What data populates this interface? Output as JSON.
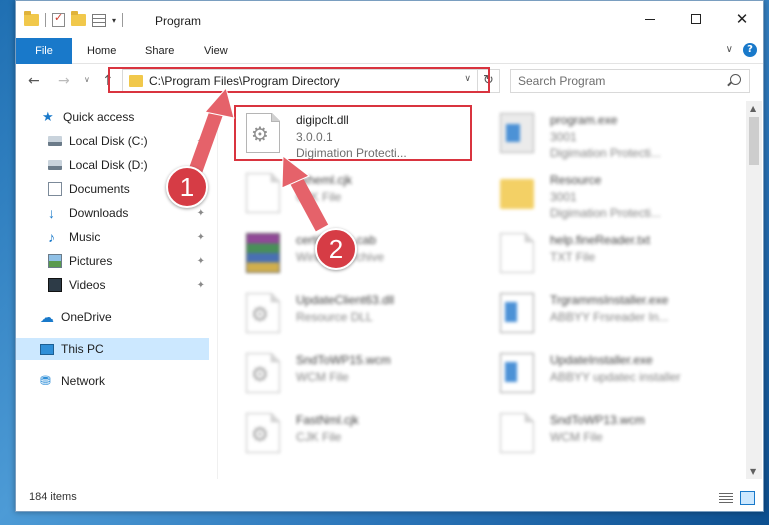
{
  "window": {
    "title": "Program",
    "min_glyph": "—",
    "close_glyph": "✕"
  },
  "ribbon": {
    "tabs": [
      "File",
      "Home",
      "Share",
      "View"
    ],
    "expand_glyph": "∨",
    "help_glyph": "?"
  },
  "address": {
    "path": "C:\\Program Files\\Program Directory",
    "back_glyph": "←",
    "forward_glyph": "→",
    "recent_glyph": "∨",
    "up_glyph": "↑",
    "dropdown_glyph": "∨",
    "refresh_glyph": "↻"
  },
  "search": {
    "placeholder": "Search Program"
  },
  "sidebar": {
    "items": [
      {
        "label": "Quick access",
        "icon": "star-icon"
      },
      {
        "label": "Local Disk (C:)",
        "icon": "drive-icon",
        "pinned": true
      },
      {
        "label": "Local Disk (D:)",
        "icon": "drive-icon",
        "pinned": true
      },
      {
        "label": "Documents",
        "icon": "documents-icon",
        "pinned": true
      },
      {
        "label": "Downloads",
        "icon": "download-icon",
        "pinned": true
      },
      {
        "label": "Music",
        "icon": "music-icon",
        "pinned": true
      },
      {
        "label": "Pictures",
        "icon": "pictures-icon",
        "pinned": true
      },
      {
        "label": "Videos",
        "icon": "videos-icon",
        "pinned": true
      },
      {
        "label": "OneDrive",
        "icon": "cloud-icon"
      },
      {
        "label": "This PC",
        "icon": "pc-icon",
        "selected": true
      },
      {
        "label": "Network",
        "icon": "network-icon"
      }
    ],
    "pin_glyph": "📌"
  },
  "files": [
    {
      "name": "digipclt.dll",
      "meta1": "3.0.0.1",
      "meta2": "Digimation Protecti...",
      "icon": "dll-icon",
      "highlighted": true
    },
    {
      "name": "program.exe",
      "meta1": "3001",
      "meta2": "Digimation Protecti...",
      "icon": "exe-icon"
    },
    {
      "name": "fixheml.cjk",
      "meta1": "CJK File",
      "meta2": "",
      "icon": "file-icon"
    },
    {
      "name": "Resource",
      "meta1": "3001",
      "meta2": "Digimation Protecti...",
      "icon": "folder-icon"
    },
    {
      "name": "certificates.cab",
      "meta1": "WinRAR archive",
      "meta2": "",
      "icon": "archive-icon"
    },
    {
      "name": "help.fineReader.txt",
      "meta1": "TXT File",
      "meta2": "",
      "icon": "file-icon"
    },
    {
      "name": "UpdateClient63.dll",
      "meta1": "Resource DLL",
      "meta2": "",
      "icon": "dll-icon"
    },
    {
      "name": "TrgrammsInstaller.exe",
      "meta1": "ABBYY Frsreader In...",
      "meta2": "",
      "icon": "installer-icon"
    },
    {
      "name": "SndToWP15.wcm",
      "meta1": "WCM File",
      "meta2": "",
      "icon": "dll-icon"
    },
    {
      "name": "UpdateInstaller.exe",
      "meta1": "ABBYY updatec installer",
      "meta2": "",
      "icon": "installer-icon"
    },
    {
      "name": "FastNml.cjk",
      "meta1": "CJK File",
      "meta2": "",
      "icon": "dll-icon"
    },
    {
      "name": "SndToWP13.wcm",
      "meta1": "WCM File",
      "meta2": "",
      "icon": "file-icon"
    }
  ],
  "status": {
    "item_count": "184 items"
  },
  "annotations": {
    "badge_1": "1",
    "badge_2": "2",
    "accent_color": "#d63c45"
  },
  "colors": {
    "file_tab": "#1979ca",
    "selected": "#cce8ff",
    "highlight_box": "#d9343f"
  }
}
